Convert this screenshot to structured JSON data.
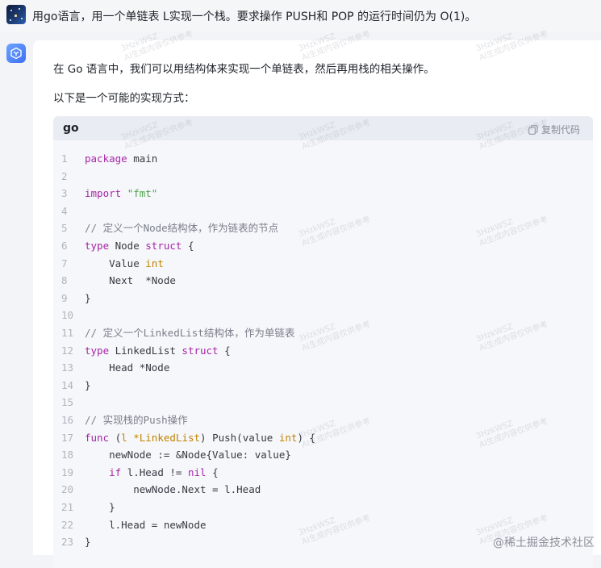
{
  "question": {
    "text": "用go语言，用一个单链表 L实现一个栈。要求操作 PUSH和 POP 的运行时间仍为 O(1)。"
  },
  "answer": {
    "intro": "在 Go 语言中，我们可以用结构体来实现一个单链表，然后再用栈的相关操作。",
    "lead": "以下是一个可能的实现方式："
  },
  "code": {
    "language": "go",
    "copy_label": "复制代码",
    "lines": [
      {
        "n": "1",
        "text": "package main"
      },
      {
        "n": "2",
        "text": ""
      },
      {
        "n": "3",
        "text": "import \"fmt\""
      },
      {
        "n": "4",
        "text": ""
      },
      {
        "n": "5",
        "text": "// 定义一个Node结构体，作为链表的节点"
      },
      {
        "n": "6",
        "text": "type Node struct {"
      },
      {
        "n": "7",
        "text": "    Value int"
      },
      {
        "n": "8",
        "text": "    Next  *Node"
      },
      {
        "n": "9",
        "text": "}"
      },
      {
        "n": "10",
        "text": ""
      },
      {
        "n": "11",
        "text": "// 定义一个LinkedList结构体，作为单链表"
      },
      {
        "n": "12",
        "text": "type LinkedList struct {"
      },
      {
        "n": "13",
        "text": "    Head *Node"
      },
      {
        "n": "14",
        "text": "}"
      },
      {
        "n": "15",
        "text": ""
      },
      {
        "n": "16",
        "text": "// 实现栈的Push操作"
      },
      {
        "n": "17",
        "text": "func (l *LinkedList) Push(value int) {"
      },
      {
        "n": "18",
        "text": "    newNode := &Node{Value: value}"
      },
      {
        "n": "19",
        "text": "    if l.Head != nil {"
      },
      {
        "n": "20",
        "text": "        newNode.Next = l.Head"
      },
      {
        "n": "21",
        "text": "    }"
      },
      {
        "n": "22",
        "text": "    l.Head = newNode"
      },
      {
        "n": "23",
        "text": "}"
      }
    ]
  },
  "watermark_text": {
    "line1": "3HzkWSZ",
    "line2": "AI生成内容仅供参考"
  },
  "site_mark": "@稀土掘金技术社区",
  "colors": {
    "page_bg": "#f2f4f7",
    "card_bg": "#ffffff",
    "code_bg": "#f6f7fb",
    "code_head_bg": "#eaecf3",
    "keyword": "#a626a4",
    "string": "#50a14f",
    "comment": "#7a7f89",
    "type": "#c18401"
  },
  "icons": {
    "user_avatar": "user-avatar-icon",
    "ai_avatar": "ai-assistant-icon",
    "copy": "copy-icon"
  }
}
